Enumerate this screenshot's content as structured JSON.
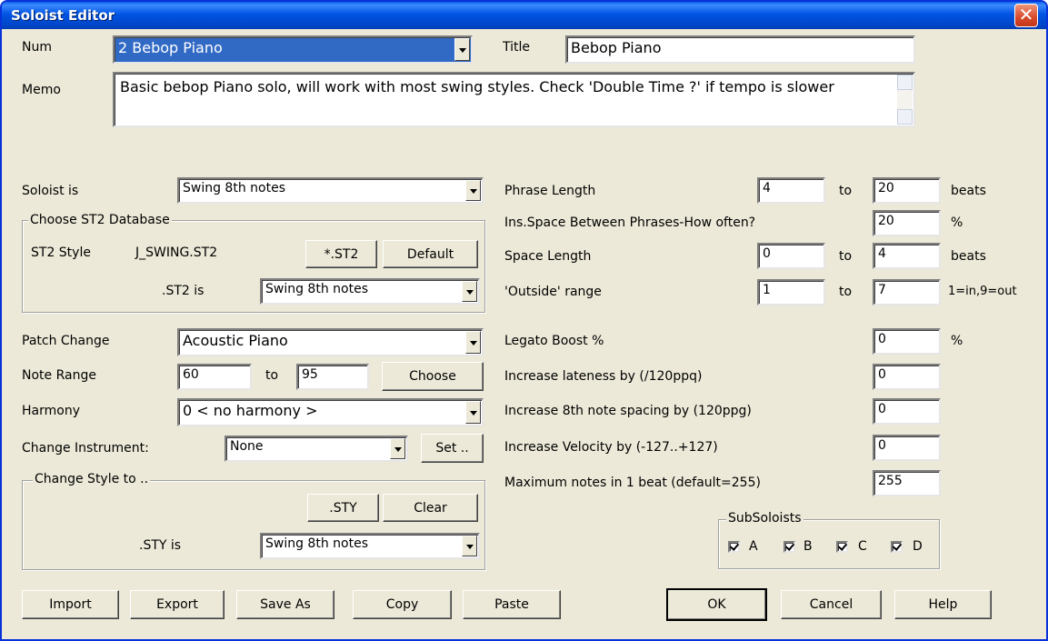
{
  "window": {
    "title": "Soloist Editor",
    "close_glyph": "✕"
  },
  "num": {
    "label": "Num",
    "value": "2 Bebop Piano"
  },
  "title_field": {
    "label": "Title",
    "value": "Bebop Piano"
  },
  "memo": {
    "label": "Memo",
    "value": "Basic bebop Piano solo, will work with most swing styles. Check 'Double Time ?' if tempo is slower"
  },
  "soloist_is": {
    "label": "Soloist is",
    "value": "Swing 8th notes"
  },
  "st2_group": {
    "title": "Choose ST2 Database",
    "style_label": "ST2 Style",
    "style_value": "J_SWING.ST2",
    "st2_button": "*.ST2",
    "default_button": "Default",
    "st2_is_label": ".ST2 is",
    "st2_is_value": "Swing 8th notes"
  },
  "patch_change": {
    "label": "Patch Change",
    "value": "Acoustic Piano"
  },
  "note_range": {
    "label": "Note Range",
    "from": "60",
    "to_label": "to",
    "to": "95",
    "choose_button": "Choose"
  },
  "harmony": {
    "label": "Harmony",
    "value": "0 < no harmony >"
  },
  "change_instrument": {
    "label": "Change Instrument:",
    "value": "None",
    "set_button": "Set .."
  },
  "style_group": {
    "title": "Change Style to ..",
    "sty_button": ".STY",
    "clear_button": "Clear",
    "sty_is_label": ".STY is",
    "sty_is_value": "Swing 8th notes"
  },
  "right": {
    "phrase_length": {
      "label": "Phrase Length",
      "from": "4",
      "to_label": "to",
      "to": "20",
      "unit": "beats"
    },
    "ins_space": {
      "label": "Ins.Space Between Phrases-How often?",
      "value": "20",
      "unit": "%"
    },
    "space_length": {
      "label": "Space Length",
      "from": "0",
      "to_label": "to",
      "to": "4",
      "unit": "beats"
    },
    "outside_range": {
      "label": "'Outside' range",
      "from": "1",
      "to_label": "to",
      "to": "7",
      "unit": "1=in,9=out"
    },
    "legato_boost": {
      "label": "Legato Boost %",
      "value": "0",
      "unit": "%"
    },
    "lateness": {
      "label": "Increase lateness by (/120ppq)",
      "value": "0"
    },
    "spacing": {
      "label": "Increase 8th note spacing by (120ppg)",
      "value": "0"
    },
    "velocity": {
      "label": "Increase Velocity by (-127..+127)",
      "value": "0"
    },
    "max_notes": {
      "label": "Maximum notes in 1 beat (default=255)",
      "value": "255"
    }
  },
  "subsoloists": {
    "title": "SubSoloists",
    "items": [
      {
        "label": "A",
        "checked": true
      },
      {
        "label": "B",
        "checked": true
      },
      {
        "label": "C",
        "checked": true
      },
      {
        "label": "D",
        "checked": true
      }
    ]
  },
  "buttons": {
    "import": "Import",
    "export": "Export",
    "save_as": "Save As",
    "copy": "Copy",
    "paste": "Paste",
    "ok": "OK",
    "cancel": "Cancel",
    "help": "Help"
  }
}
